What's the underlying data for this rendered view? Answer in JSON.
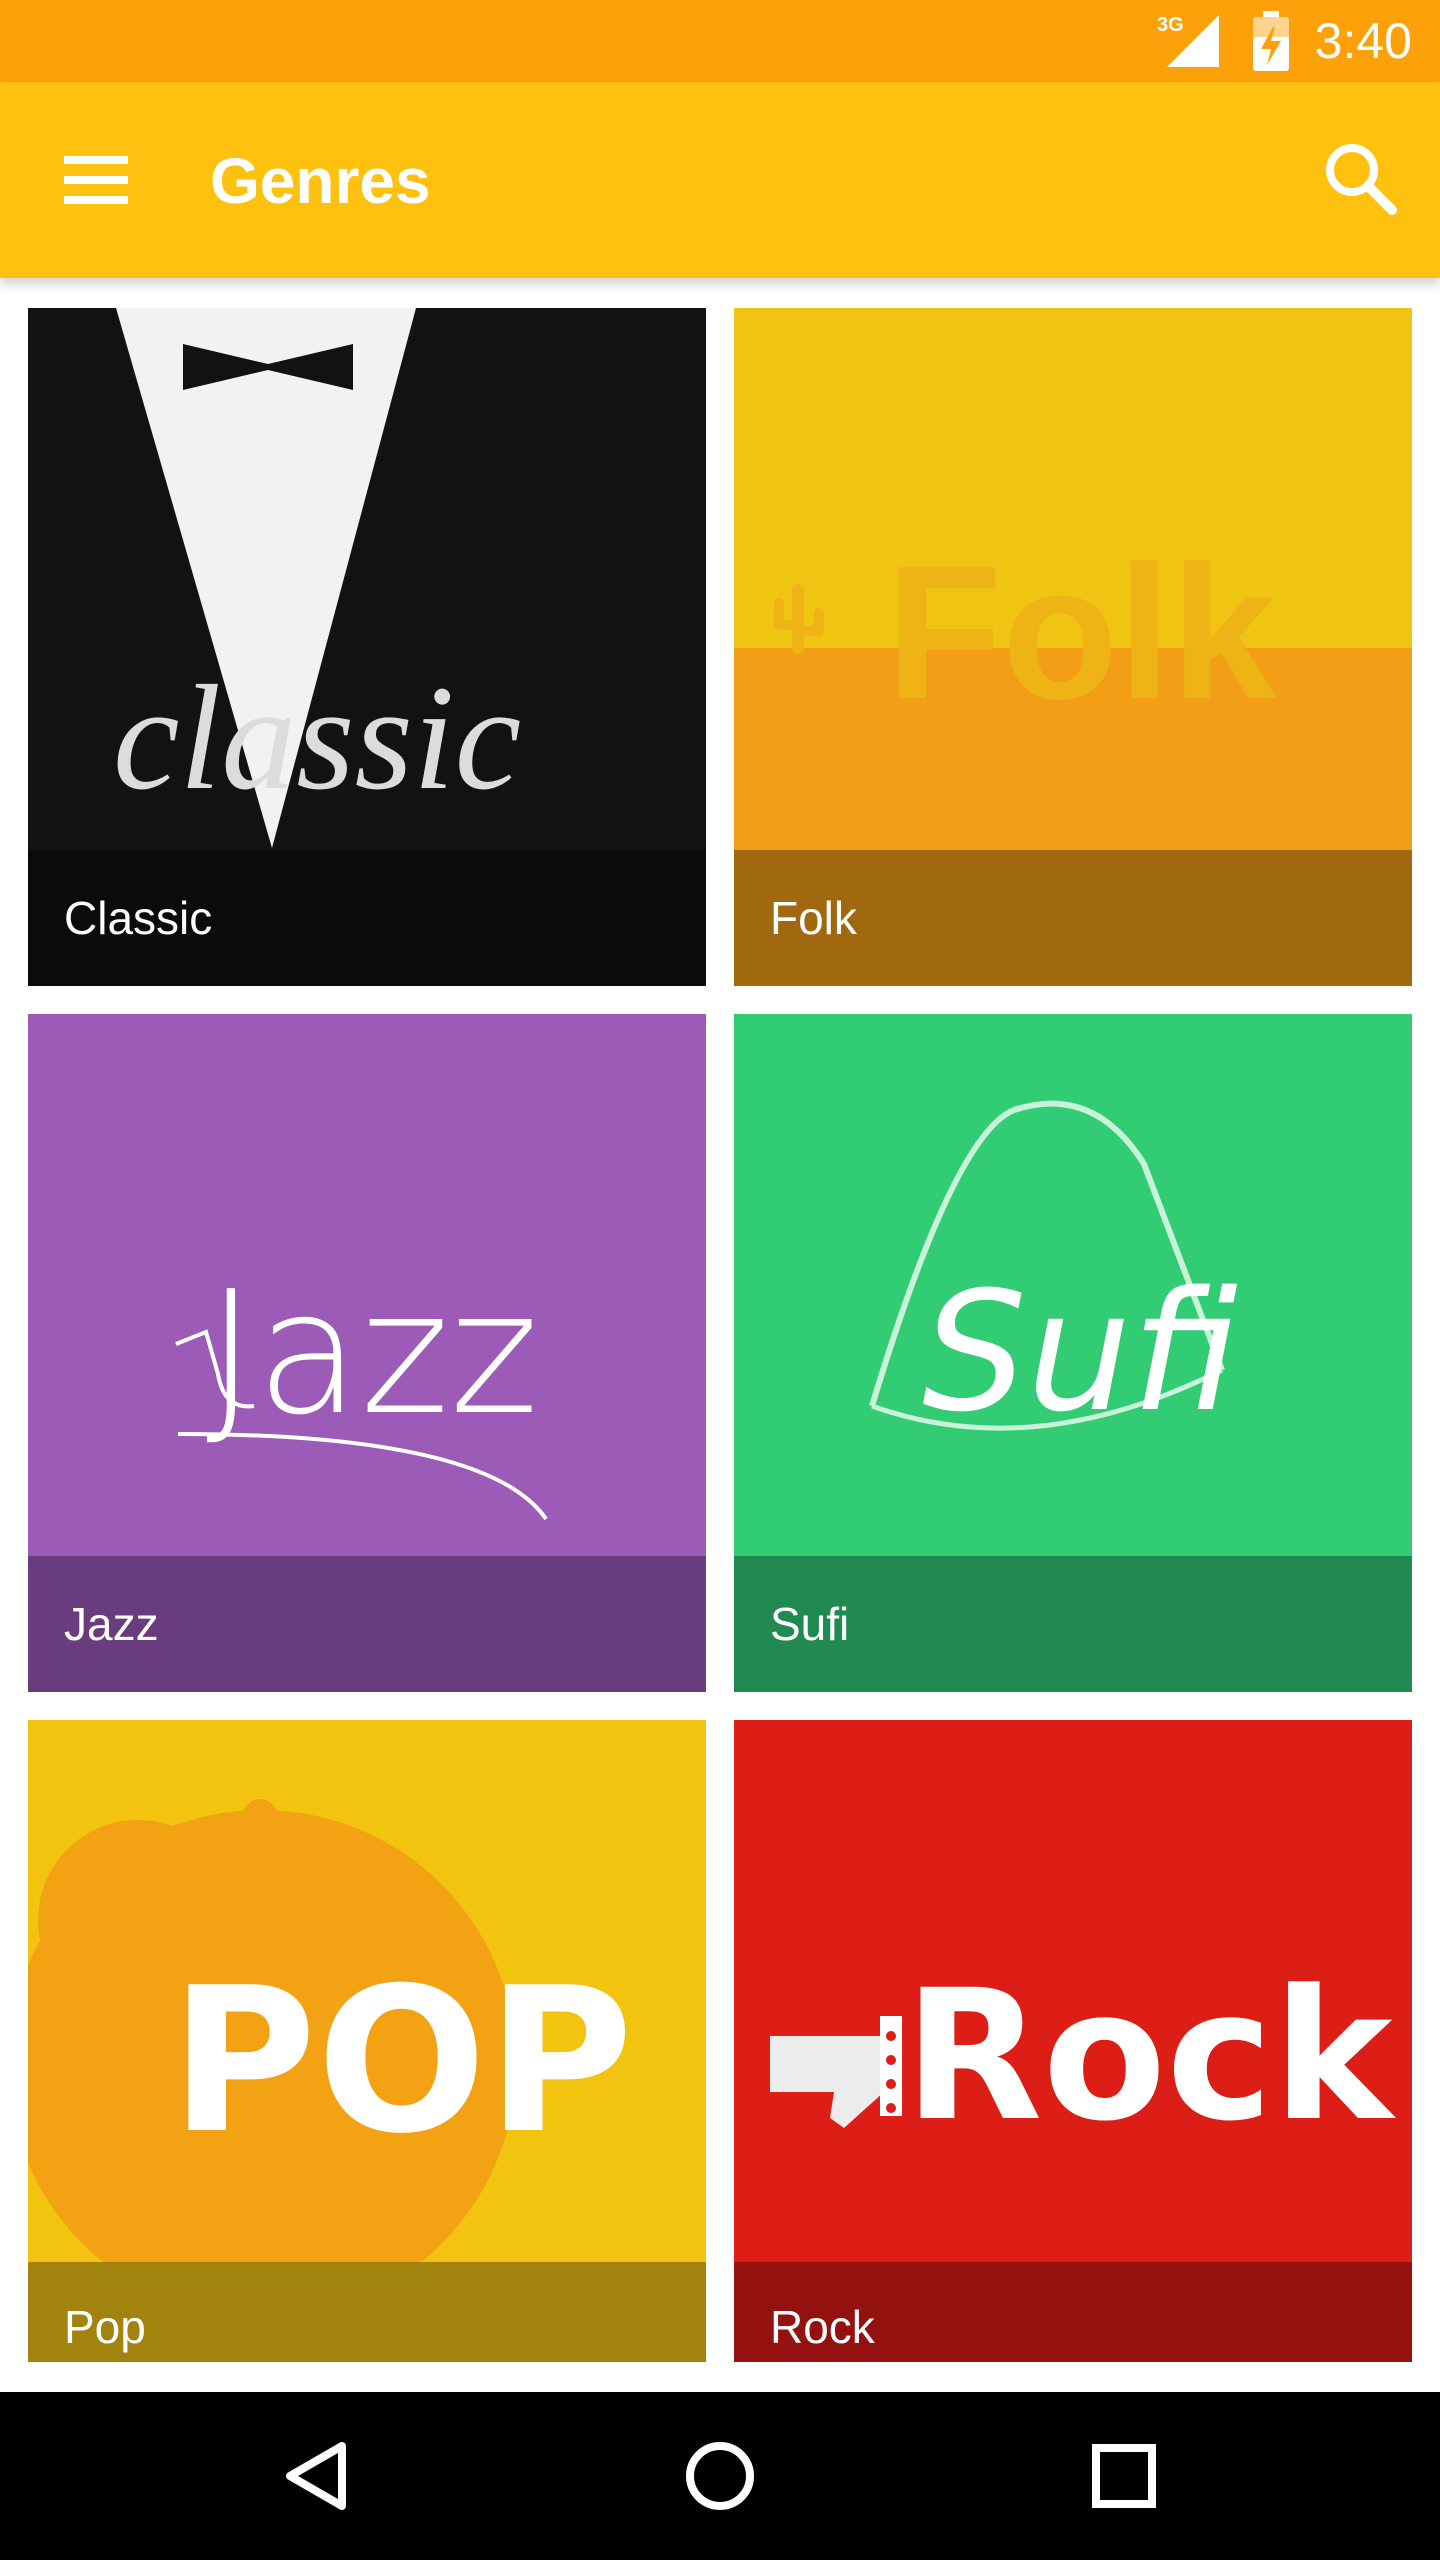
{
  "status_bar": {
    "network_label": "3G",
    "time": "3:40",
    "icons": [
      "signal-icon",
      "battery-charging-icon"
    ]
  },
  "app_bar": {
    "title": "Genres",
    "icons": [
      "menu-icon",
      "search-icon"
    ]
  },
  "colors": {
    "status_bar": "#fda10a",
    "app_bar": "#fec10f",
    "classic": "#121214",
    "folk": "#efc413",
    "jazz": "#9b5bb7",
    "sufi": "#32cc74",
    "pop": "#f2c30f",
    "rock": "#dc1e17"
  },
  "genres": [
    {
      "label": "Classic",
      "art_text": "classic"
    },
    {
      "label": "Folk",
      "art_text": "Folk"
    },
    {
      "label": "Jazz",
      "art_text": "Jazz"
    },
    {
      "label": "Sufi",
      "art_text": "Sufi"
    },
    {
      "label": "Pop",
      "art_text": "POP"
    },
    {
      "label": "Rock",
      "art_text": "Rock"
    }
  ],
  "nav_bar": {
    "icons": [
      "back-icon",
      "home-icon",
      "recents-icon"
    ]
  }
}
